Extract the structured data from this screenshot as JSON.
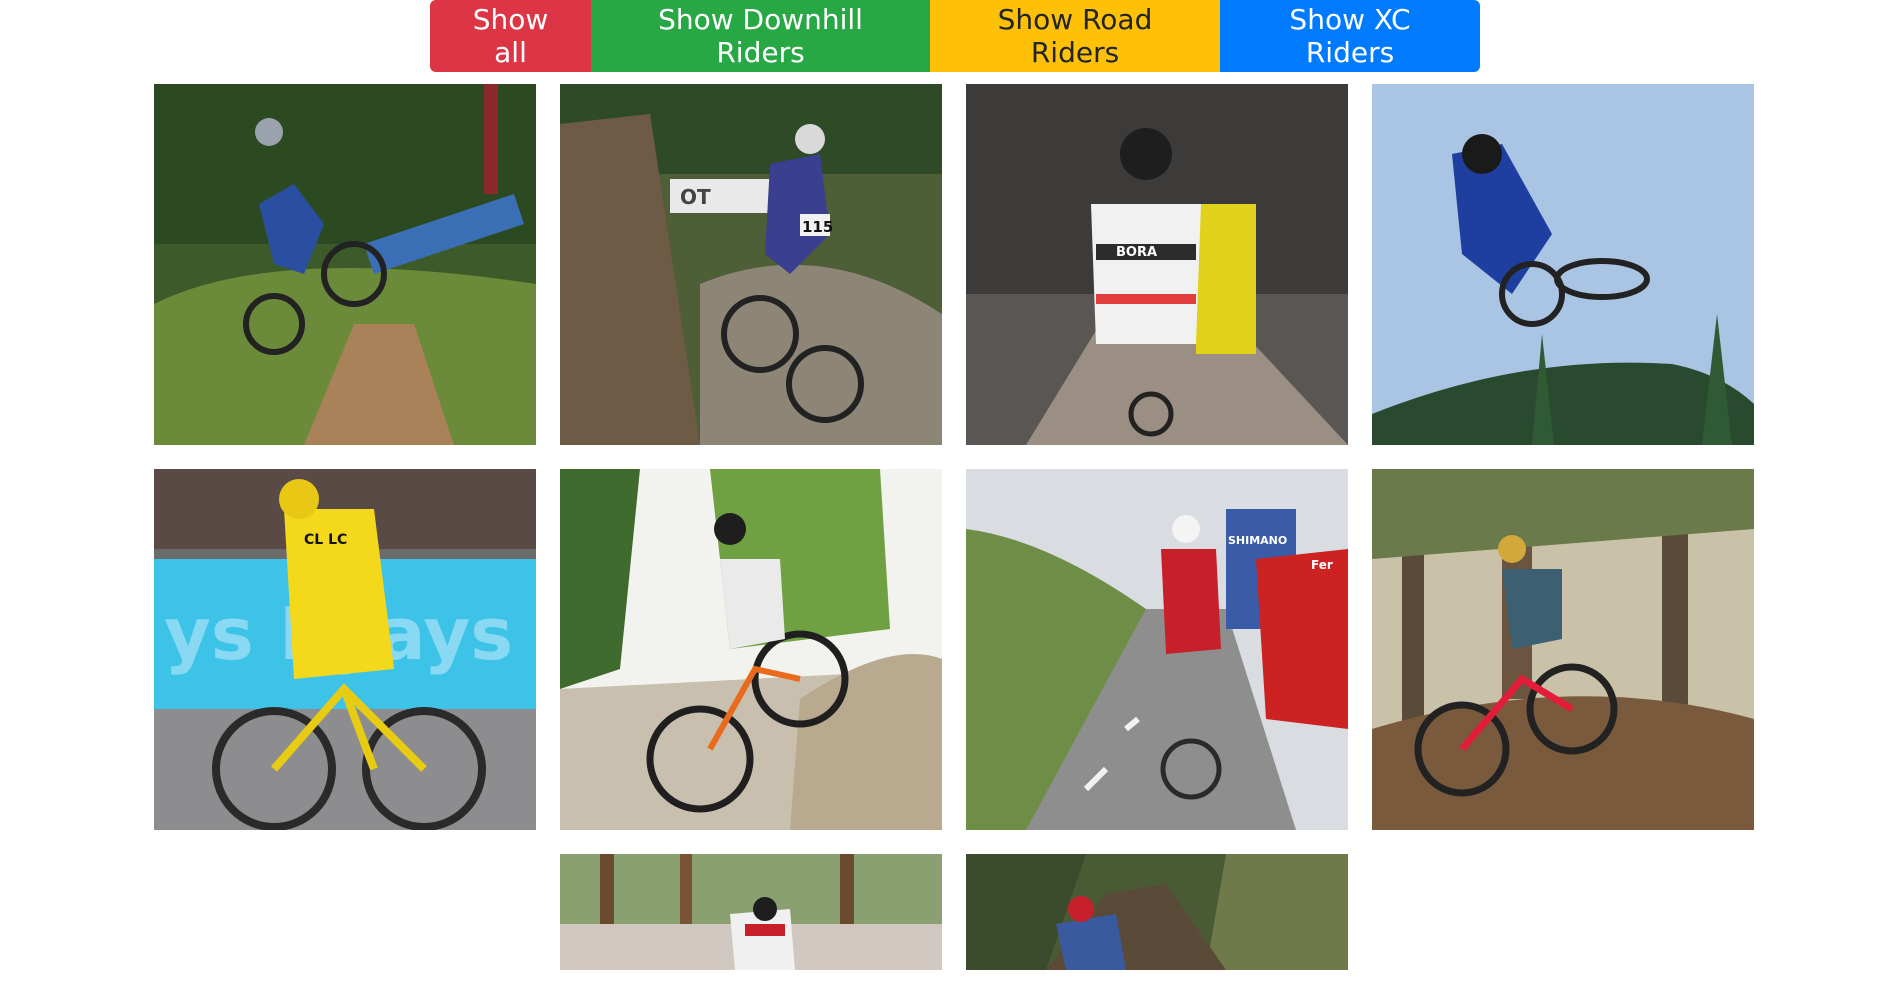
{
  "filters": {
    "show_all": "Show all",
    "show_downhill": "Show Downhill Riders",
    "show_road": "Show Road Riders",
    "show_xc": "Show XC Riders"
  },
  "colors": {
    "show_all": "#dc3545",
    "show_downhill": "#28a745",
    "show_road": "#ffc107",
    "show_xc": "#007bff"
  },
  "photo_text": {
    "p2_banner": "OT",
    "p2_plate": "115",
    "p3_jersey": "BORA",
    "p5_jersey": "CL LC",
    "p5_banner": "ys Kyays",
    "p7_car_banner": "SHIMANO",
    "p7_car_side": "Fer"
  },
  "gallery": [
    {
      "category": "downhill",
      "icon": "downhill-rider-jump-photo"
    },
    {
      "category": "downhill",
      "icon": "downhill-rider-rock-photo"
    },
    {
      "category": "road",
      "icon": "road-rider-cobbles-photo"
    },
    {
      "category": "downhill",
      "icon": "downhill-rider-sky-jump-photo"
    },
    {
      "category": "road",
      "icon": "road-rider-yellow-jersey-photo"
    },
    {
      "category": "xc",
      "icon": "xc-rider-rocks-photo"
    },
    {
      "category": "road",
      "icon": "road-rider-climb-photo"
    },
    {
      "category": "xc",
      "icon": "xc-rider-forest-photo"
    },
    {
      "category": "xc",
      "icon": "xc-rider-forest-race-photo"
    },
    {
      "category": "downhill",
      "icon": "downhill-rider-forest-photo"
    }
  ]
}
